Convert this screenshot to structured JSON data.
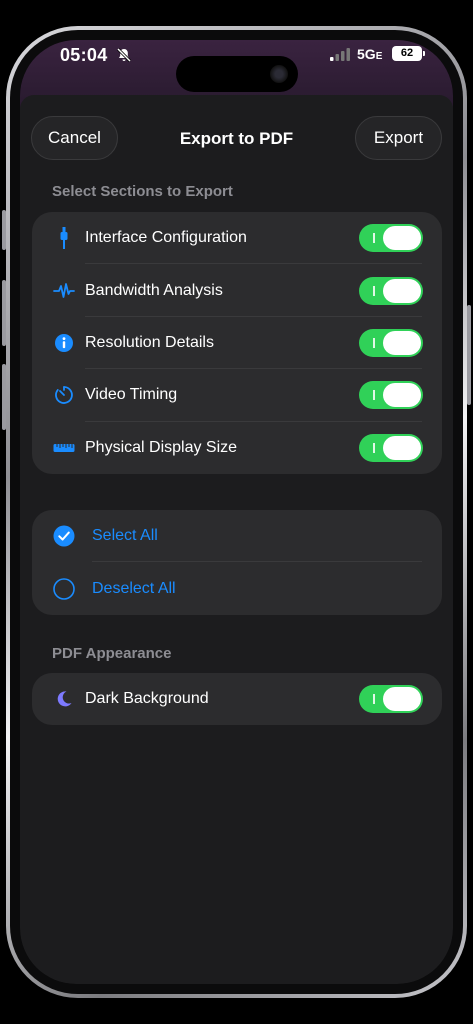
{
  "status_bar": {
    "time": "05:04",
    "network": "5G",
    "network_suffix": "E",
    "battery": "62"
  },
  "sheet": {
    "title": "Export to PDF",
    "cancel_label": "Cancel",
    "export_label": "Export"
  },
  "sections_header": "Select Sections to Export",
  "sections": [
    {
      "label": "Interface Configuration",
      "icon": "cable-connector-icon",
      "enabled": true
    },
    {
      "label": "Bandwidth Analysis",
      "icon": "waveform-icon",
      "enabled": true
    },
    {
      "label": "Resolution Details",
      "icon": "info-circle-icon",
      "enabled": true
    },
    {
      "label": "Video Timing",
      "icon": "timer-icon",
      "enabled": true
    },
    {
      "label": "Physical Display Size",
      "icon": "ruler-icon",
      "enabled": true
    }
  ],
  "selection": {
    "select_all": "Select All",
    "deselect_all": "Deselect All"
  },
  "appearance_header": "PDF Appearance",
  "appearance": {
    "dark_background_label": "Dark Background",
    "dark_background_enabled": true
  },
  "colors": {
    "accent": "#1a8cff",
    "toggle_on": "#30d158",
    "moon": "#7d7aff"
  }
}
